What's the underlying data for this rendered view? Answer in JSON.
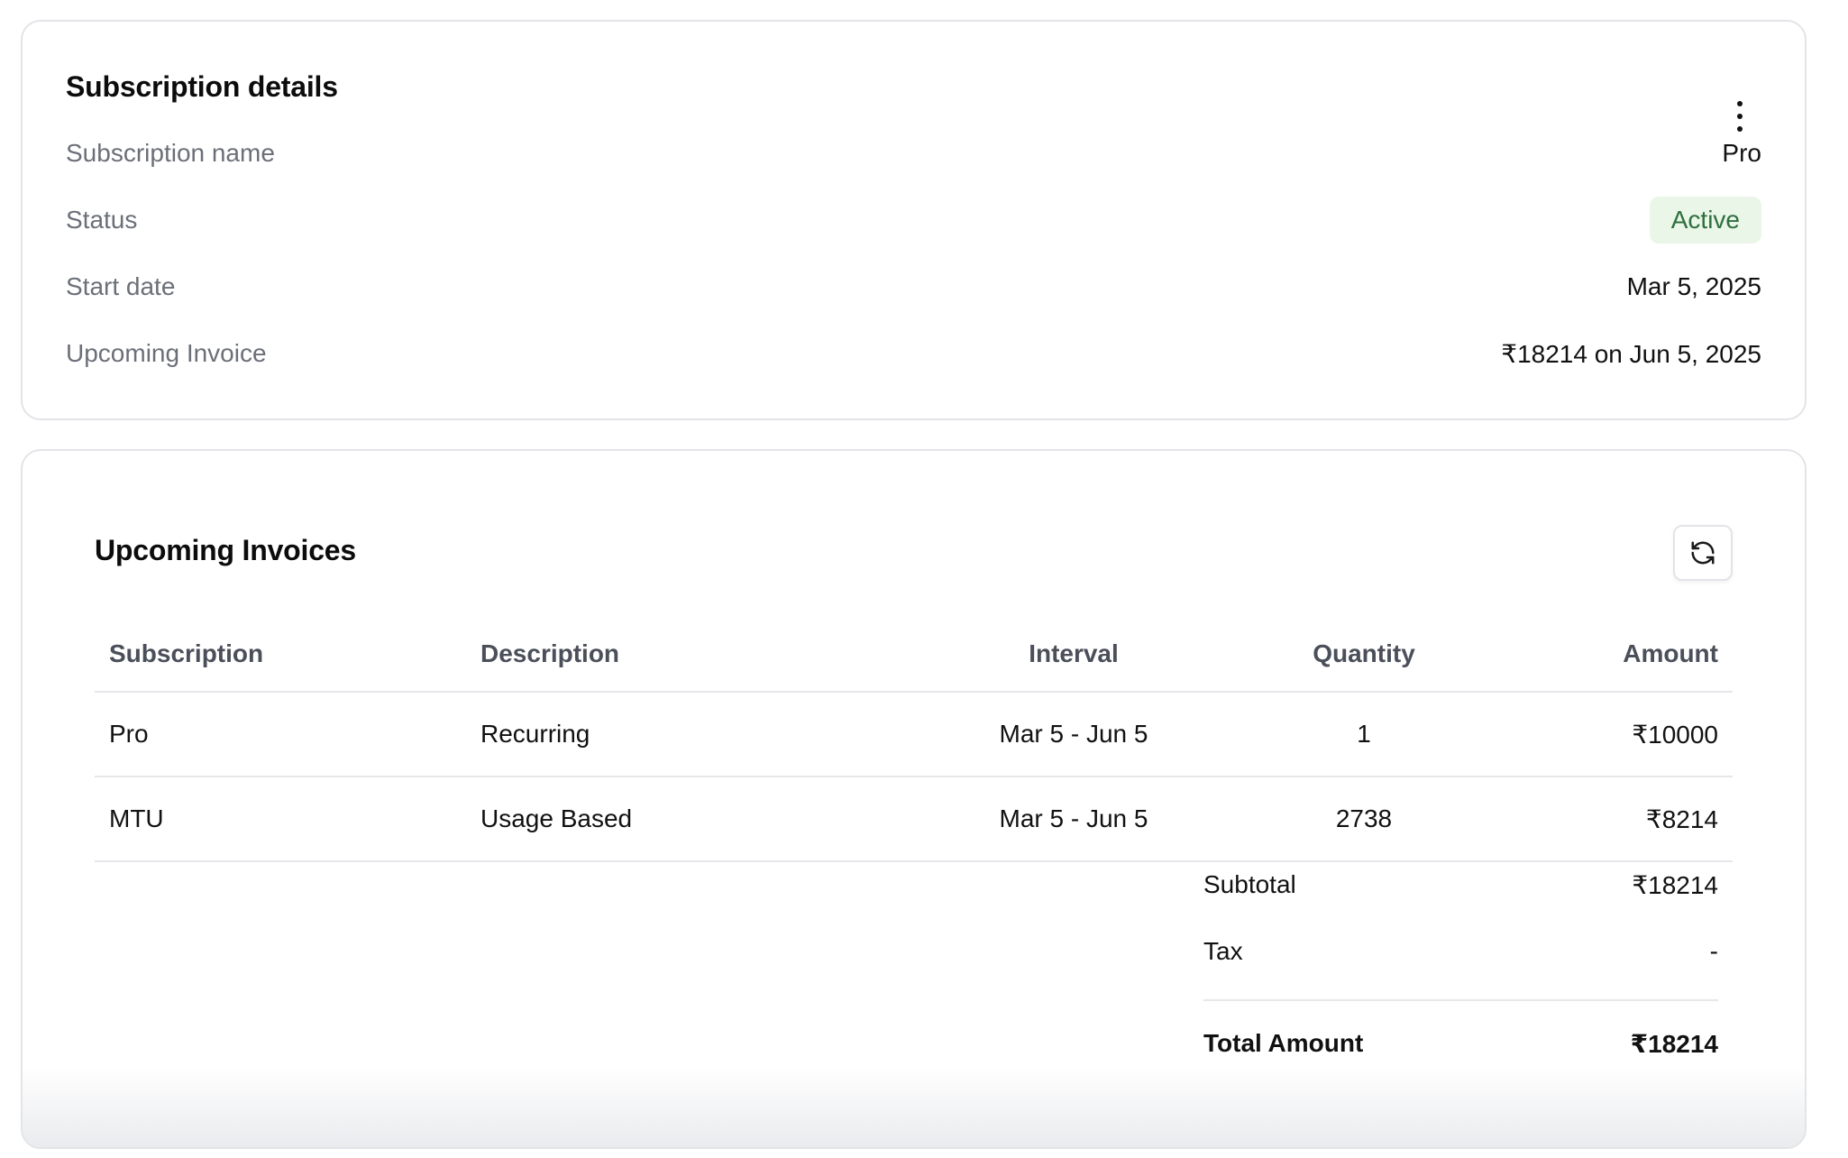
{
  "details": {
    "title": "Subscription details",
    "rows": [
      {
        "label": "Subscription name",
        "value": "Pro"
      },
      {
        "label": "Status",
        "value": "Active"
      },
      {
        "label": "Start date",
        "value": "Mar 5, 2025"
      },
      {
        "label": "Upcoming Invoice",
        "value": "₹18214 on Jun 5, 2025"
      }
    ],
    "menu_icon": "more-vertical-icon"
  },
  "invoices": {
    "title": "Upcoming Invoices",
    "refresh_icon": "refresh-icon",
    "columns": [
      "Subscription",
      "Description",
      "Interval",
      "Quantity",
      "Amount"
    ],
    "rows": [
      {
        "subscription": "Pro",
        "description": "Recurring",
        "interval": "Mar 5 - Jun 5",
        "quantity": "1",
        "amount": "₹10000"
      },
      {
        "subscription": "MTU",
        "description": "Usage Based",
        "interval": "Mar 5 - Jun 5",
        "quantity": "2738",
        "amount": "₹8214"
      }
    ],
    "summary": {
      "subtotal_label": "Subtotal",
      "subtotal_value": "₹18214",
      "tax_label": "Tax",
      "tax_value": "-",
      "total_label": "Total Amount",
      "total_value": "₹18214"
    }
  },
  "colors": {
    "active_badge_bg": "#eaf6e8",
    "active_badge_text": "#2f6f3f",
    "muted_label": "#6b6f78",
    "border": "#e3e4e8"
  }
}
